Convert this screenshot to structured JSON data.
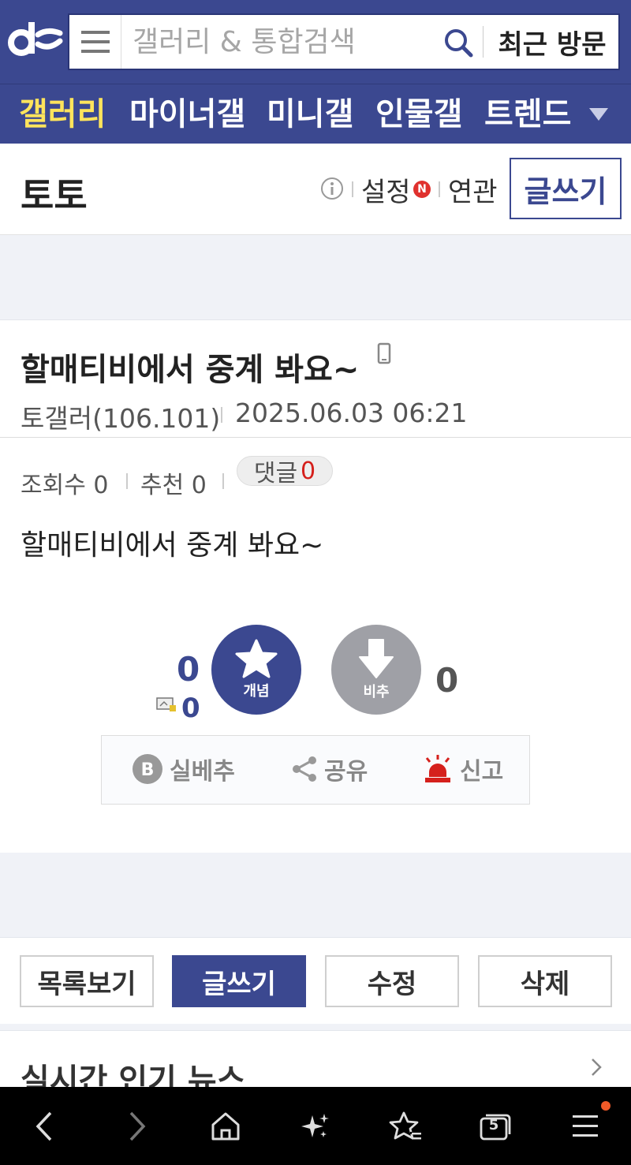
{
  "header": {
    "search_placeholder": "갤러리 & 통합검색",
    "recent_label": "최근 방문"
  },
  "nav": {
    "items": [
      {
        "label": "갤러리"
      },
      {
        "label": "마이너갤"
      },
      {
        "label": "미니갤"
      },
      {
        "label": "인물갤"
      },
      {
        "label": "트렌드"
      }
    ]
  },
  "gallery": {
    "title": "토토",
    "settings_label": "설정",
    "new_badge": "N",
    "related_label": "연관",
    "write_label": "글쓰기"
  },
  "post": {
    "title": "할매티비에서 중계 봐요~",
    "author": "토갤러(106.101)",
    "date": "2025.06.03 06:21",
    "views_label": "조회수 0",
    "recommend_label": "추천 0",
    "comments_label": "댓글",
    "comments_count": "0",
    "body": "할매티비에서 중계 봐요~"
  },
  "votes": {
    "up_count": "0",
    "fixed_count": "0",
    "up_label": "개념",
    "down_label": "비추",
    "down_count": "0"
  },
  "actions": {
    "best_label": "실베추",
    "share_label": "공유",
    "report_label": "신고"
  },
  "bottom": {
    "list_label": "목록보기",
    "write_label": "글쓰기",
    "edit_label": "수정",
    "delete_label": "삭제"
  },
  "news": {
    "title": "실시간 인기 뉴스"
  },
  "browser": {
    "tab_count": "5"
  },
  "colors": {
    "brand": "#3b4890",
    "active_nav": "#ffe45c",
    "comment_count": "#d5201c",
    "report": "#d5201c"
  }
}
